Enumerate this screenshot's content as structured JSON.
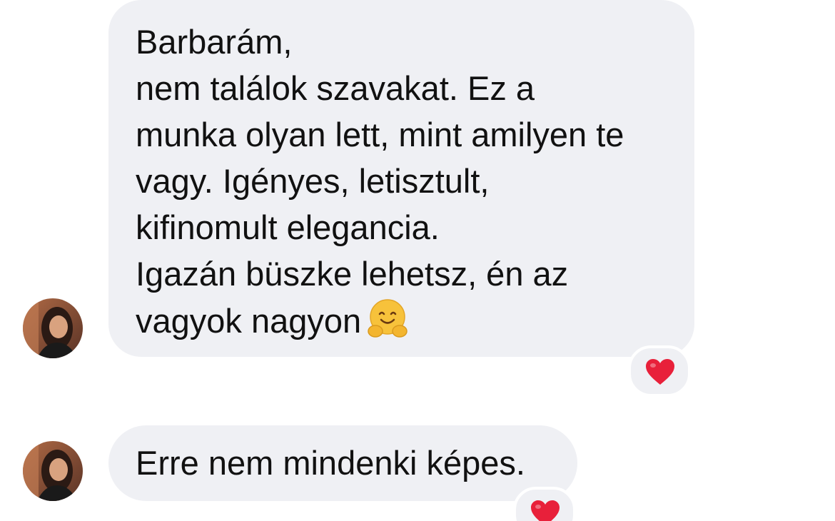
{
  "messages": [
    {
      "sender": "other",
      "lines": [
        "Barbarám,",
        "nem találok szavakat. Ez a",
        "munka olyan lett, mint amilyen te",
        "vagy. Igényes, letisztult,",
        "kifinomult elegancia.",
        "Igazán büszke lehetsz, én az",
        "vagyok nagyon"
      ],
      "emoji": "hugging-face-emoji",
      "reaction": "heart-icon"
    },
    {
      "sender": "other",
      "text": "Erre nem mindenki képes.",
      "reaction": "heart-icon"
    }
  ],
  "colors": {
    "bubble_bg": "#eff0f4",
    "text": "#111111",
    "heart": "#e8203a"
  }
}
